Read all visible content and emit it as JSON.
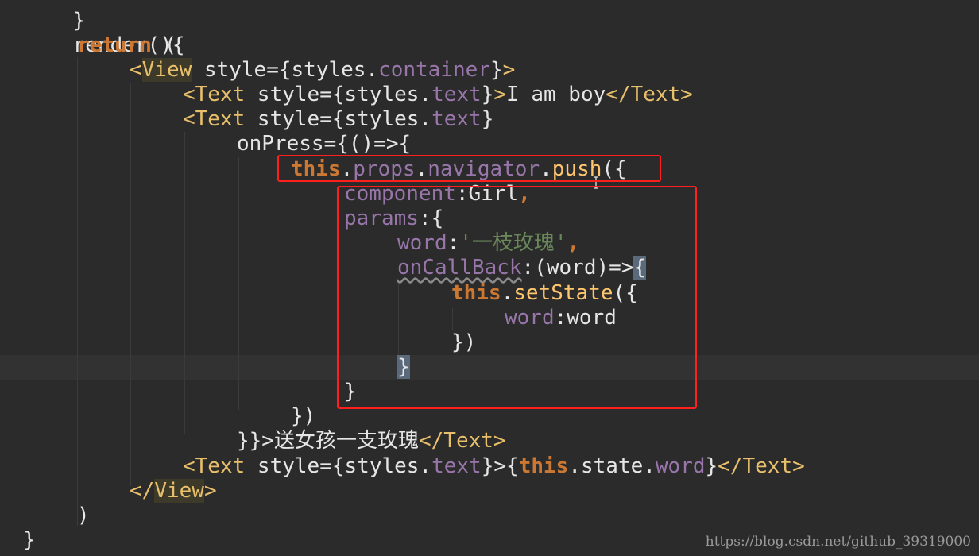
{
  "colors": {
    "background": "#2b2b2b",
    "keyword": "#cc7832",
    "tag": "#e8bf6a",
    "property": "#9876aa",
    "string": "#6a8759",
    "text": "#e6e6e6",
    "highlight_box": "#ff1f1f"
  },
  "code": {
    "line0": {
      "t0": "}"
    },
    "line1": {
      "t0": "render(){"
    },
    "line2": {
      "t0": "return",
      "t1": " ("
    },
    "line3": {
      "t0": "<",
      "t1": "View",
      "t2": " style={styles.",
      "t3": "container",
      "t4": "}",
      "t5": ">"
    },
    "line4": {
      "t0": "<Text",
      "t1": " style={styles.",
      "t2": "text",
      "t3": "}",
      "t4": ">",
      "t5": "I am boy",
      "t6": "</Text>"
    },
    "line5": {
      "t0": "<Text",
      "t1": " style={styles.",
      "t2": "text",
      "t3": "}"
    },
    "line6": {
      "t0": "onPress={()=>{"
    },
    "line7": {
      "t0": "this",
      "t1": ".",
      "t2": "props",
      "t3": ".",
      "t4": "navigator",
      "t5": ".",
      "t6": "push",
      "t7": "({"
    },
    "line8": {
      "t0": "component",
      "t1": ":Girl",
      "t2": ","
    },
    "line9": {
      "t0": "params",
      "t1": ":{"
    },
    "line10": {
      "t0": "word",
      "t1": ":",
      "t2": "'一枝玫瑰'",
      "t3": ","
    },
    "line11": {
      "t0": "onCallBack",
      "t1": ":(word)=>",
      "t2": "{"
    },
    "line12": {
      "t0": "this",
      "t1": ".",
      "t2": "setState",
      "t3": "({"
    },
    "line13": {
      "t0": "word",
      "t1": ":word"
    },
    "line14": {
      "t0": "})"
    },
    "line15": {
      "t0": "}"
    },
    "line16": {
      "t0": "}"
    },
    "line17": {
      "t0": "})"
    },
    "line18": {
      "t0": "}}>",
      "t1": "送女孩一支玫瑰",
      "t2": "</Text>"
    },
    "line19": {
      "t0": "<Text",
      "t1": " style={styles.",
      "t2": "text",
      "t3": "}",
      "t4": ">{",
      "t5": "this",
      "t6": ".state.",
      "t7": "word",
      "t8": "}",
      "t9": "</Text>"
    },
    "line20": {
      "t0": "</",
      "t1": "View",
      "t2": ">"
    },
    "line21": {
      "t0": ")"
    },
    "line22": {
      "t0": "}"
    }
  },
  "watermark": "https://blog.csdn.net/github_39319000"
}
